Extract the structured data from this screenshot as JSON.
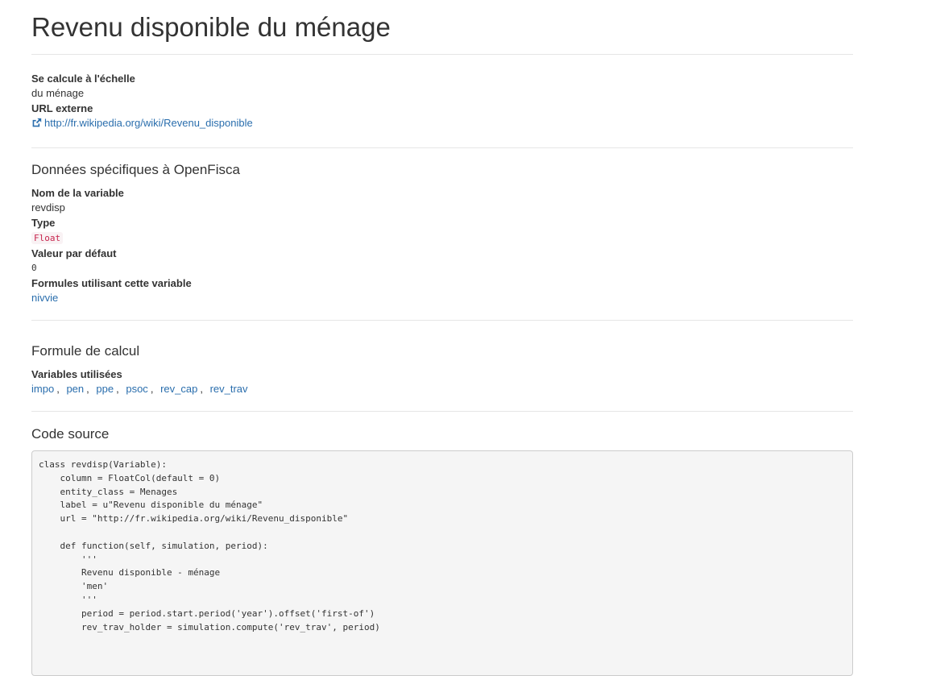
{
  "page": {
    "title": "Revenu disponible du ménage"
  },
  "general": {
    "scale_label": "Se calcule à l'échelle",
    "scale_value": "du ménage",
    "url_label": "URL externe",
    "url_text": "http://fr.wikipedia.org/wiki/Revenu_disponible",
    "url_icon": "external-link-icon"
  },
  "openfisca": {
    "heading": "Données spécifiques à OpenFisca",
    "name_label": "Nom de la variable",
    "name_value": "revdisp",
    "type_label": "Type",
    "type_value": "Float",
    "default_label": "Valeur par défaut",
    "default_value": "0",
    "formulas_label": "Formules utilisant cette variable",
    "formulas_value": "nivvie"
  },
  "formula": {
    "heading": "Formule de calcul",
    "vars_label": "Variables utilisées",
    "variables": [
      "impo",
      "pen",
      "ppe",
      "psoc",
      "rev_cap",
      "rev_trav"
    ]
  },
  "code": {
    "heading": "Code source",
    "source": "class revdisp(Variable):\n    column = FloatCol(default = 0)\n    entity_class = Menages\n    label = u\"Revenu disponible du ménage\"\n    url = \"http://fr.wikipedia.org/wiki/Revenu_disponible\"\n\n    def function(self, simulation, period):\n        '''\n        Revenu disponible - ménage\n        'men'\n        '''\n        period = period.start.period('year').offset('first-of')\n        rev_trav_holder = simulation.compute('rev_trav', period)"
  }
}
